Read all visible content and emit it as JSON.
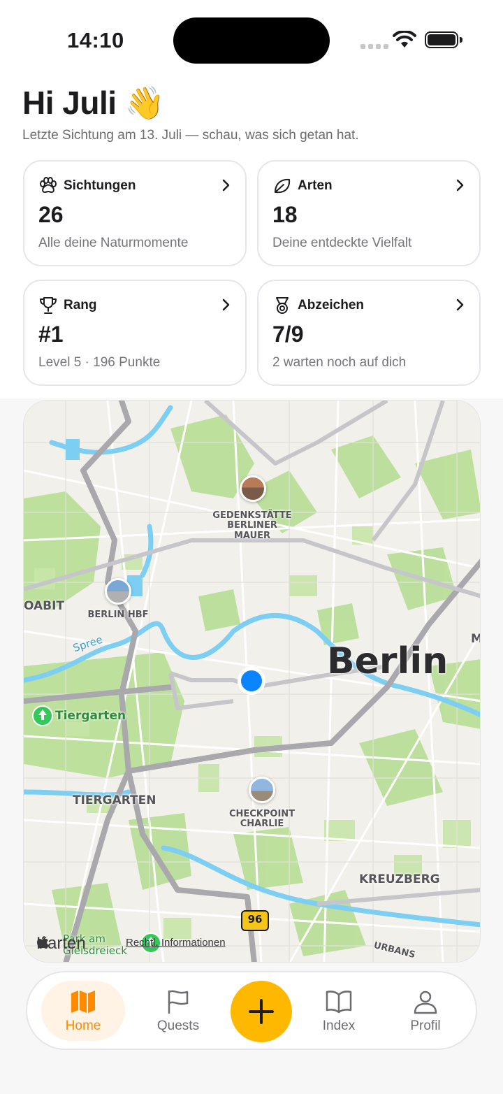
{
  "status": {
    "time": "14:10"
  },
  "header": {
    "greeting": "Hi Juli",
    "emoji": "👋",
    "subtitle": "Letzte Sichtung am 13. Juli — schau, was sich getan hat."
  },
  "cards": [
    {
      "icon": "paw-icon",
      "title": "Sichtungen",
      "value": "26",
      "desc": "Alle deine Naturmomente"
    },
    {
      "icon": "leaf-icon",
      "title": "Arten",
      "value": "18",
      "desc": "Deine entdeckte Vielfalt"
    },
    {
      "icon": "trophy-icon",
      "title": "Rang",
      "value": "#1",
      "desc": "Level 5 · 196 Punkte"
    },
    {
      "icon": "medal-icon",
      "title": "Abzeichen",
      "value": "7/9",
      "desc": "2 warten noch auf dich"
    }
  ],
  "map": {
    "city": "Berlin",
    "labels": {
      "mauer": "GEDENKSTÄTTE\nBERLINER\nMAUER",
      "hbf": "BERLIN HBF",
      "moabit": "OABIT",
      "spree": "Spree",
      "tiergarten_park": "Tiergarten",
      "tiergarten_district": "TIERGARTEN",
      "checkpoint": "CHECKPOINT\nCHARLIE",
      "kreuzberg": "KREUZBERG",
      "route": "96",
      "urban": "URBANS",
      "edge_m": "M",
      "park": "Park am\nGleisdreieck",
      "attribution": "Karten",
      "legal": "Rechtl. Informationen"
    }
  },
  "nav": {
    "items": [
      {
        "label": "Home",
        "icon": "map-icon",
        "active": true
      },
      {
        "label": "Quests",
        "icon": "flag-icon",
        "active": false
      },
      {
        "label": "Index",
        "icon": "book-icon",
        "active": false
      },
      {
        "label": "Profil",
        "icon": "person-icon",
        "active": false
      }
    ],
    "add_icon": "plus-icon"
  },
  "colors": {
    "accent": "#ffb800",
    "accent_text": "#ff8a00",
    "active_bg": "#fff3e6",
    "location": "#0a84ff"
  }
}
